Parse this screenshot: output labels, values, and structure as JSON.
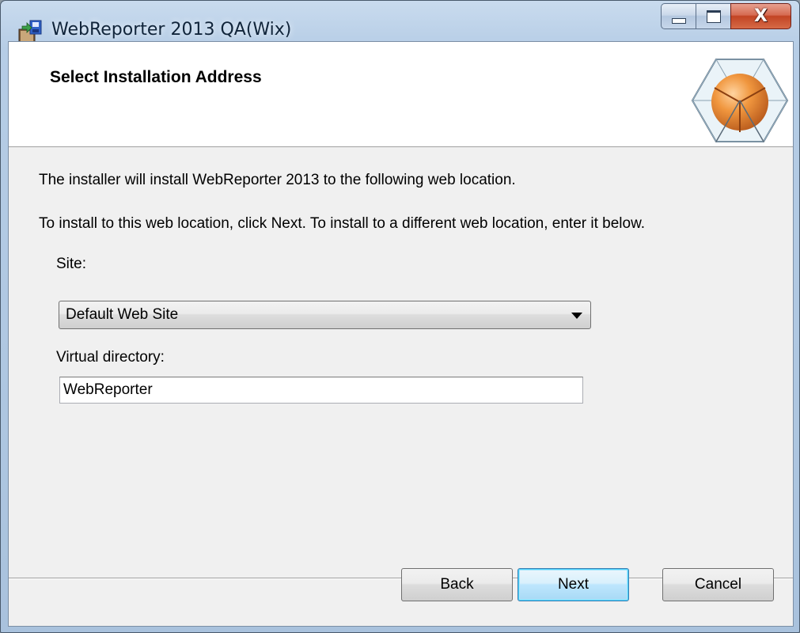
{
  "window": {
    "title": "WebReporter 2013 QA(Wix)",
    "app_icon": "installer-package-icon",
    "caption_buttons": {
      "minimize_icon": "minimize-icon",
      "maximize_icon": "maximize-icon",
      "close_glyph": "X"
    }
  },
  "banner": {
    "title": "Select Installation Address",
    "logo": "hexagon-sphere-logo"
  },
  "body": {
    "line1": "The installer will install WebReporter 2013 to the following web location.",
    "line2": "To install to this web location, click Next. To install to a different web location, enter it below."
  },
  "site": {
    "label": "Site:",
    "value": "Default Web Site",
    "icon": "chevron-down-icon"
  },
  "virtual_directory": {
    "label": "Virtual directory:",
    "value": "WebReporter"
  },
  "buttons": {
    "back": "Back",
    "next": "Next",
    "cancel": "Cancel"
  },
  "colors": {
    "accent_orange": "#e88a3a",
    "default_button_border": "#3c7fb1",
    "close_button": "#c24424"
  }
}
